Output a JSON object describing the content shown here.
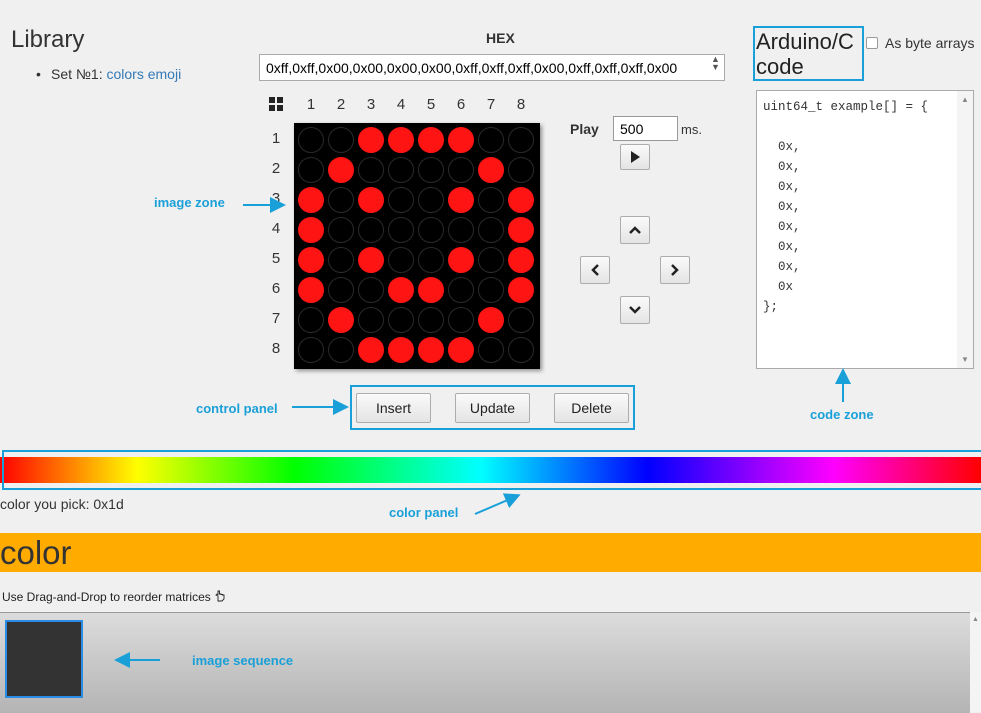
{
  "library": {
    "title": "Library",
    "set_prefix": "Set №1: ",
    "set_link": "colors emoji"
  },
  "hex": {
    "label": "HEX",
    "value": "0xff,0xff,0x00,0x00,0x00,0x00,0xff,0xff,0xff,0x00,0xff,0xff,0xff,0x00"
  },
  "grid": {
    "columns": [
      "1",
      "2",
      "3",
      "4",
      "5",
      "6",
      "7",
      "8"
    ],
    "rows": [
      "1",
      "2",
      "3",
      "4",
      "5",
      "6",
      "7",
      "8"
    ],
    "led_color": "#ff1414",
    "pixels": [
      [
        0,
        0,
        1,
        1,
        1,
        1,
        0,
        0
      ],
      [
        0,
        1,
        0,
        0,
        0,
        0,
        1,
        0
      ],
      [
        1,
        0,
        1,
        0,
        0,
        1,
        0,
        1
      ],
      [
        1,
        0,
        0,
        0,
        0,
        0,
        0,
        1
      ],
      [
        1,
        0,
        1,
        0,
        0,
        1,
        0,
        1
      ],
      [
        1,
        0,
        0,
        1,
        1,
        0,
        0,
        1
      ],
      [
        0,
        1,
        0,
        0,
        0,
        0,
        1,
        0
      ],
      [
        0,
        0,
        1,
        1,
        1,
        1,
        0,
        0
      ]
    ]
  },
  "play": {
    "label": "Play",
    "value": "500",
    "unit": "ms."
  },
  "arduino": {
    "title": "Arduino/C code",
    "byte_arrays_label": "As byte arrays",
    "code": "uint64_t example[] = {\n\n  0x,\n  0x,\n  0x,\n  0x,\n  0x,\n  0x,\n  0x,\n  0x\n};"
  },
  "controls": {
    "insert": "Insert",
    "update": "Update",
    "delete": "Delete"
  },
  "color": {
    "pick_text": "color you pick: 0x1d",
    "band_text": "color"
  },
  "sequence": {
    "dnd_text": "Use Drag-and-Drop to reorder matrices",
    "frame_color": "#333333"
  },
  "annotations": {
    "image_zone": "image zone",
    "control_panel": "control panel",
    "code_zone": "code zone",
    "color_panel": "color panel",
    "image_sequence": "image sequence"
  },
  "icons": {
    "play": "play-icon",
    "up": "chevron-up-icon",
    "down": "chevron-down-icon",
    "left": "chevron-left-icon",
    "right": "chevron-right-icon",
    "grid": "grid-icon",
    "hand": "hand-pointer-icon"
  },
  "accent_color": "#1aa0d8"
}
